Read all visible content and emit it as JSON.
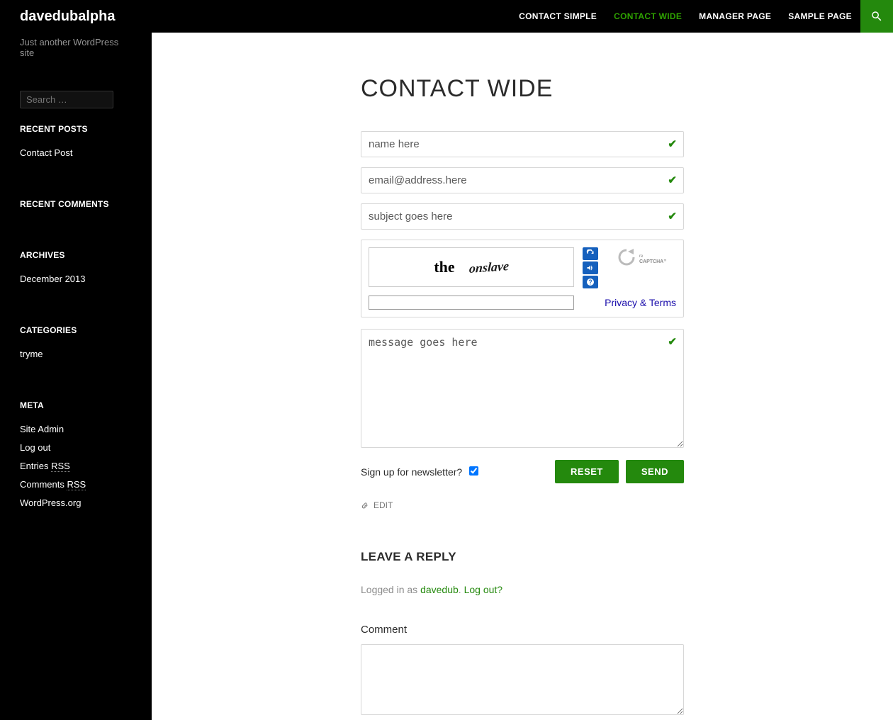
{
  "header": {
    "site_title": "davedubalpha",
    "nav": [
      {
        "label": "CONTACT SIMPLE",
        "active": false
      },
      {
        "label": "CONTACT WIDE",
        "active": true
      },
      {
        "label": "MANAGER PAGE",
        "active": false
      },
      {
        "label": "SAMPLE PAGE",
        "active": false
      }
    ]
  },
  "sidebar": {
    "tagline": "Just another WordPress site",
    "search_placeholder": "Search …",
    "widgets": {
      "recent_posts": {
        "title": "RECENT POSTS",
        "items": [
          "Contact Post"
        ]
      },
      "recent_comments": {
        "title": "RECENT COMMENTS"
      },
      "archives": {
        "title": "ARCHIVES",
        "items": [
          "December 2013"
        ]
      },
      "categories": {
        "title": "CATEGORIES",
        "items": [
          "tryme"
        ]
      },
      "meta": {
        "title": "META",
        "items": {
          "site_admin": "Site Admin",
          "log_out": "Log out",
          "entries_prefix": "Entries ",
          "entries_rss": "RSS",
          "comments_prefix": "Comments ",
          "comments_rss": "RSS",
          "wp_org": "WordPress.org"
        }
      }
    }
  },
  "page": {
    "title": "CONTACT WIDE",
    "form": {
      "name_placeholder": "name here",
      "email_placeholder": "email@address.here",
      "subject_placeholder": "subject goes here",
      "message_placeholder": "message goes here",
      "newsletter_label": "Sign up for newsletter?",
      "newsletter_checked": true,
      "reset_label": "RESET",
      "send_label": "SEND"
    },
    "captcha": {
      "word1": "the",
      "word2": "onslave",
      "privacy_terms": "Privacy & Terms"
    },
    "edit_label": "EDIT",
    "reply": {
      "title": "LEAVE A REPLY",
      "logged_in_prefix": "Logged in as ",
      "username": "davedub",
      "logout_text": "Log out?",
      "comment_label": "Comment"
    }
  }
}
